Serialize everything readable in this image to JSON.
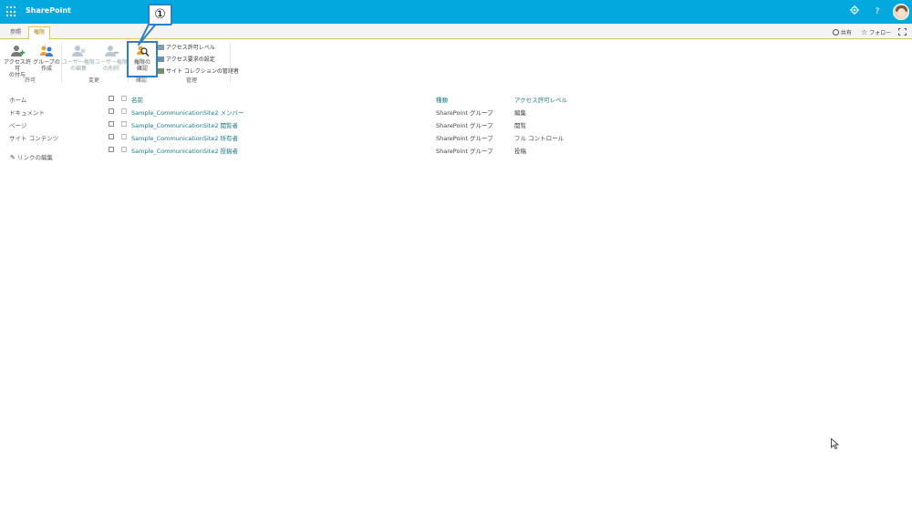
{
  "suite": {
    "title": "SharePoint",
    "settings_icon": "gear-icon",
    "help_label": "?"
  },
  "tabs": [
    {
      "label": "参照"
    },
    {
      "label": "権限"
    }
  ],
  "tab_actions": {
    "share": "共有",
    "follow": "フォロー"
  },
  "ribbon": {
    "grant_permission": "アクセス許可\nの付与",
    "create_group": "グループの\n作成",
    "edit_user_permissions": "ユーザー権限\nの編集",
    "remove_user_permissions": "ユーザー権限\nの削除",
    "check_permissions": "権限の\n確認",
    "permission_levels": "アクセス許可レベル",
    "access_request_settings": "アクセス要求の設定",
    "site_collection_admins": "サイト コレクションの管理者",
    "group_grant": "許可",
    "group_modify": "変更",
    "group_check": "確認",
    "group_manage": "管理"
  },
  "callout": {
    "label": "①"
  },
  "nav": {
    "items": [
      "ホーム",
      "ドキュメント",
      "ページ",
      "サイト コンテンツ"
    ],
    "edit_links": "リンクの編集"
  },
  "table": {
    "headers": {
      "name": "名前",
      "type": "種類",
      "level": "アクセス許可レベル"
    },
    "rows": [
      {
        "name": "Sample_CommunicationSite2 メンバー",
        "type": "SharePoint グループ",
        "level": "編集"
      },
      {
        "name": "Sample_CommunicationSite2 閲覧者",
        "type": "SharePoint グループ",
        "level": "閲覧"
      },
      {
        "name": "Sample_CommunicationSite2 所有者",
        "type": "SharePoint グループ",
        "level": "フル コントロール"
      },
      {
        "name": "Sample_CommunicationSite2 投稿者",
        "type": "SharePoint グループ",
        "level": "投稿"
      }
    ]
  },
  "colors": {
    "suite_bar": "#03a9de",
    "link": "#1a7a86",
    "accent_tab": "#b47c00",
    "highlight": "#2f7fc7"
  }
}
